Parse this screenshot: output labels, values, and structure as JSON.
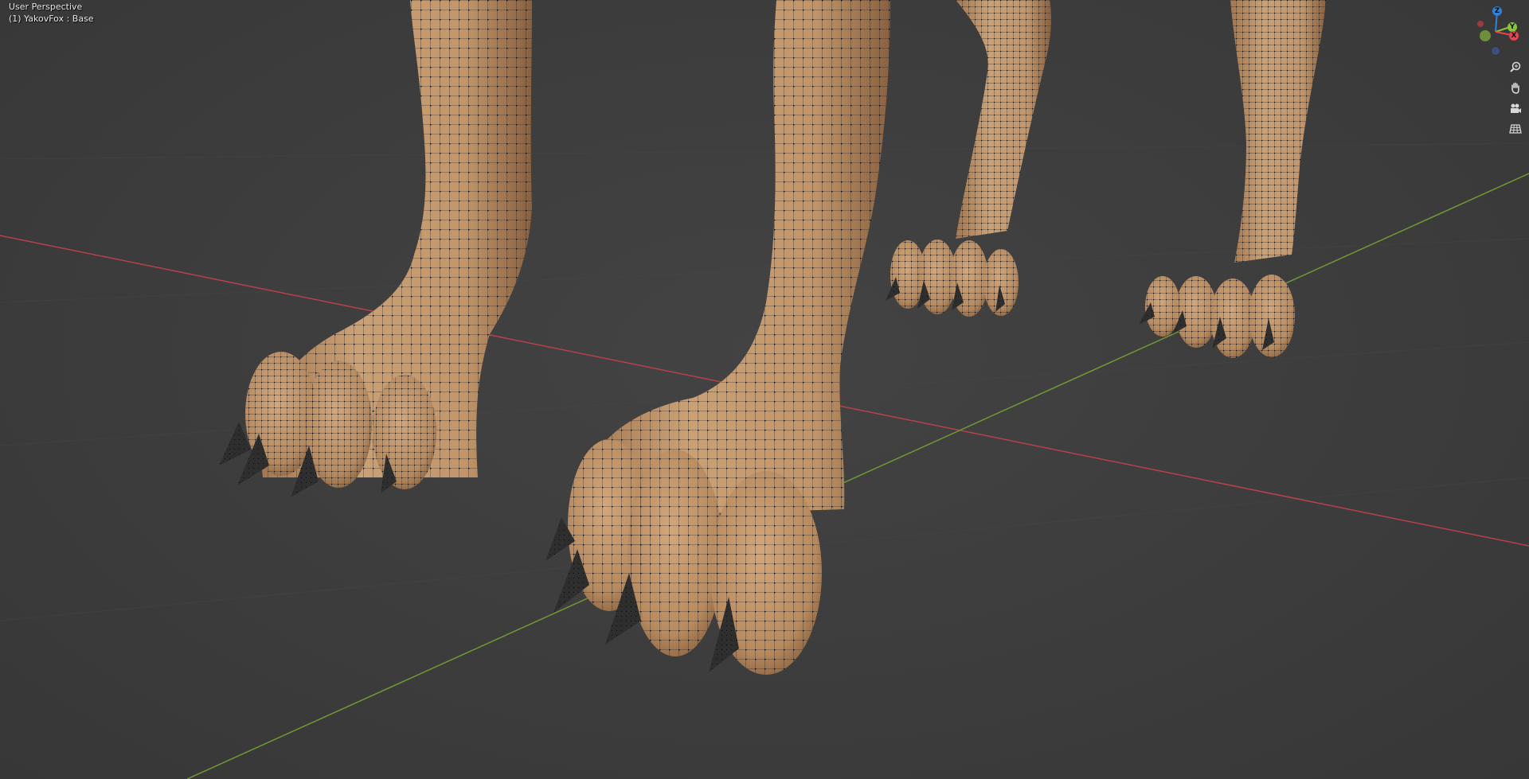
{
  "viewport": {
    "view_name": "User Perspective",
    "object_info": "(1) YakovFox : Base"
  },
  "gizmo": {
    "z_label": "Z",
    "y_label": "Y",
    "x_label": "X",
    "colors": {
      "x": "#e8434e",
      "y": "#8ac33d",
      "z": "#2e80d8",
      "neg": "#3b4f7a"
    }
  },
  "nav": {
    "zoom_icon": "magnifier-icon",
    "pan_icon": "hand-icon",
    "camera_icon": "camera-icon",
    "grid_icon": "grid-icon"
  },
  "scene": {
    "mesh_color": "#c89a6e",
    "wire_color": "#111111",
    "claw_color": "#2e2e2e",
    "x_axis_color": "#b8414b",
    "y_axis_color": "#6f9a35"
  }
}
